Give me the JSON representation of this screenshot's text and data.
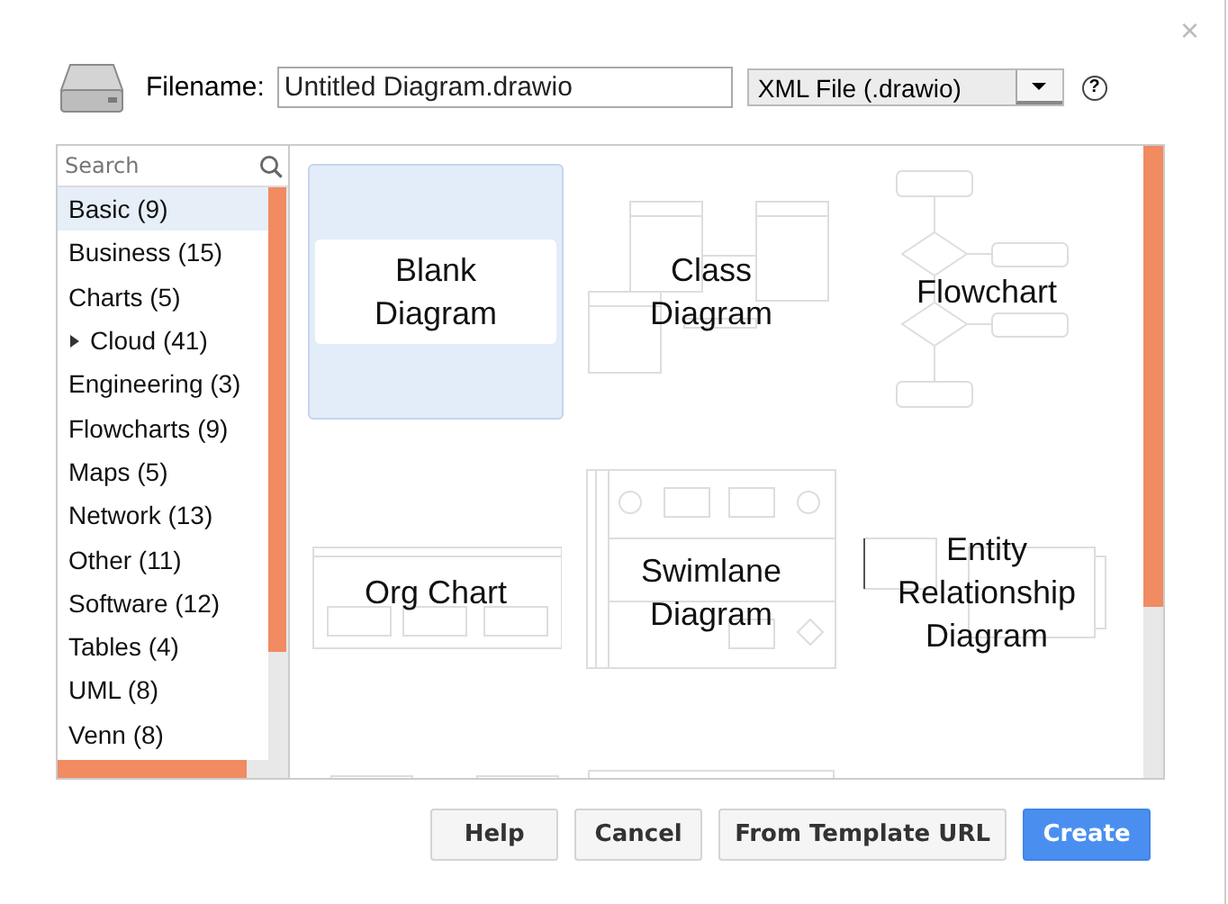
{
  "dialog": {
    "close": "×"
  },
  "filename": {
    "label": "Filename:",
    "value": "Untitled Diagram.drawio"
  },
  "format": {
    "value": "XML File (.drawio)",
    "help": "?"
  },
  "search": {
    "placeholder": "Search"
  },
  "categories": [
    {
      "label": "Basic (9)",
      "selected": true,
      "expandable": false
    },
    {
      "label": "Business (15)",
      "selected": false,
      "expandable": false
    },
    {
      "label": "Charts (5)",
      "selected": false,
      "expandable": false
    },
    {
      "label": "Cloud (41)",
      "selected": false,
      "expandable": true
    },
    {
      "label": "Engineering (3)",
      "selected": false,
      "expandable": false
    },
    {
      "label": "Flowcharts (9)",
      "selected": false,
      "expandable": false
    },
    {
      "label": "Maps (5)",
      "selected": false,
      "expandable": false
    },
    {
      "label": "Network (13)",
      "selected": false,
      "expandable": false
    },
    {
      "label": "Other (11)",
      "selected": false,
      "expandable": false
    },
    {
      "label": "Software (12)",
      "selected": false,
      "expandable": false
    },
    {
      "label": "Tables (4)",
      "selected": false,
      "expandable": false
    },
    {
      "label": "UML (8)",
      "selected": false,
      "expandable": false
    },
    {
      "label": "Venn (8)",
      "selected": false,
      "expandable": false
    }
  ],
  "templates": [
    {
      "kind": "blank",
      "label": "Blank Diagram",
      "selected": true
    },
    {
      "kind": "class",
      "label": "Class Diagram",
      "selected": false
    },
    {
      "kind": "flowchart",
      "label": "Flowchart",
      "selected": false
    },
    {
      "kind": "org",
      "label": "Org Chart",
      "selected": false
    },
    {
      "kind": "swimlane",
      "label": "Swimlane Diagram",
      "selected": false
    },
    {
      "kind": "er",
      "label": "Entity Relationship Diagram",
      "selected": false
    },
    {
      "kind": "sequence",
      "selected": false
    },
    {
      "kind": "kanban",
      "selected": false
    }
  ],
  "buttons": [
    {
      "label": "Help",
      "primary": false
    },
    {
      "label": "Cancel",
      "primary": false
    },
    {
      "label": "From Template URL",
      "primary": false
    },
    {
      "label": "Create",
      "primary": true
    }
  ]
}
